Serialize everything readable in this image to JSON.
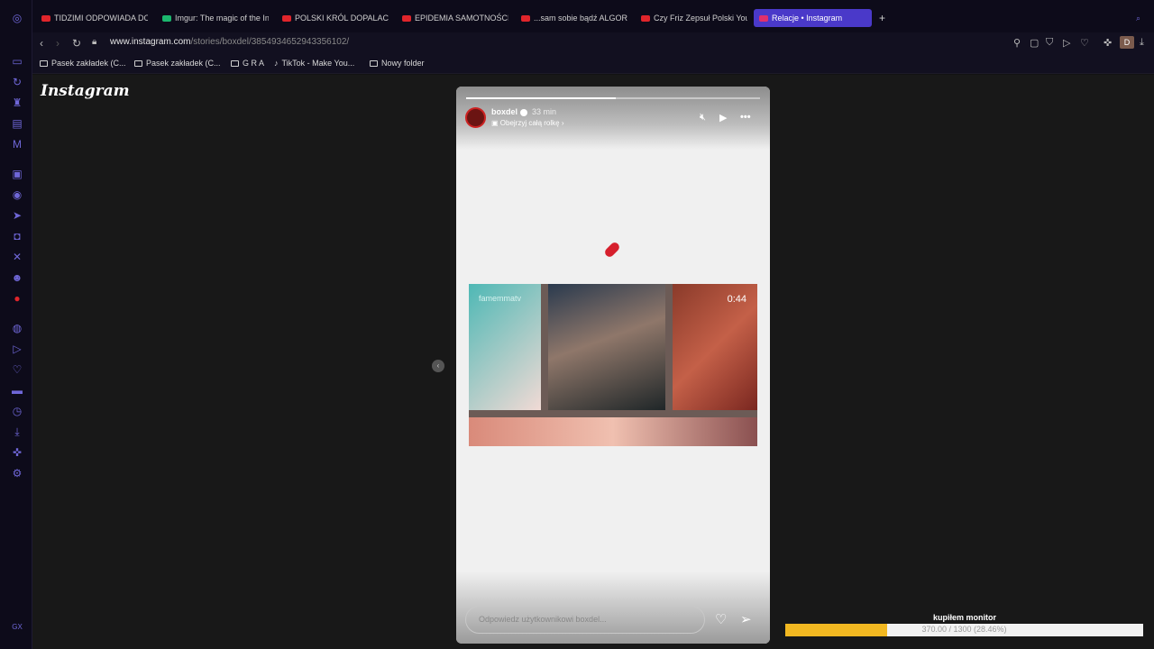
{
  "tabs": [
    {
      "label": "TIDZIMI ODPOWIADA DOK",
      "icon": "youtube-icon"
    },
    {
      "label": "Imgur: The magic of the In",
      "icon": "imgur-icon"
    },
    {
      "label": "POLSKI KRÓL DOPALACZ",
      "icon": "youtube-icon"
    },
    {
      "label": "EPIDEMIA SAMOTNOŚCI",
      "icon": "youtube-icon"
    },
    {
      "label": "...sam sobie bądź ALGORY",
      "icon": "youtube-icon"
    },
    {
      "label": "Czy Friz Zepsuł Polski You",
      "icon": "youtube-icon"
    },
    {
      "label": "Relacje • Instagram",
      "icon": "instagram-icon"
    }
  ],
  "address": {
    "domain": "www.instagram.com",
    "path": "/stories/boxdel/3854934652943356102/"
  },
  "bookmarks": [
    "Pasek zakładek (C...",
    "Pasek zakładek (C...",
    "G R A",
    "TikTok - Make You...",
    "Nowy folder"
  ],
  "profile_initial": "D",
  "instagram_logo": "Instagram",
  "story": {
    "username": "boxdel",
    "time": "33 min",
    "subline": "Obejrzyj całą rolkę",
    "progress": 0.51,
    "video_watermark": "famemmatv",
    "video_duration": "0:44",
    "reply_placeholder": "Odpowiedz użytkownikowi boxdel..."
  },
  "overlay": {
    "label": "kupiłem monitor",
    "progress_text": "370.00 / 1300 (28.46%)",
    "progress": 0.2846
  },
  "colors": {
    "accent": "#4a39c9",
    "bar": "#f2b821",
    "youtube": "#e0252b"
  }
}
